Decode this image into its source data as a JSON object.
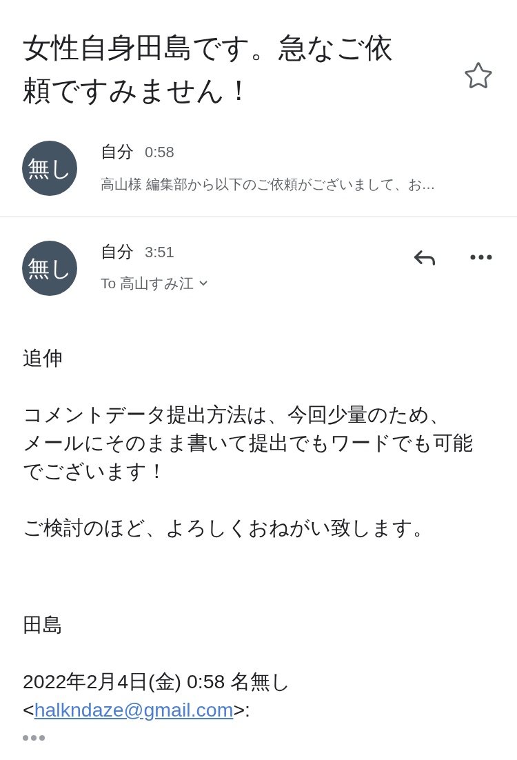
{
  "subject": "女性自身田島です。急なご依頼ですみません！",
  "starred": false,
  "messages": [
    {
      "kind": "collapsed",
      "avatar": "無し",
      "sender": "自分",
      "time": "0:58",
      "snippet": "高山様 編集部から以下のご依頼がございまして、お…"
    },
    {
      "kind": "expanded",
      "avatar": "無し",
      "sender": "自分",
      "time": "3:51",
      "to_label": "To",
      "to": "高山すみ江"
    }
  ],
  "body": [
    {
      "lines": [
        "追伸"
      ]
    },
    {
      "lines": [
        "コメントデータ提出方法は、今回少量のため、",
        "メールにそのまま書いて提出でもワードでも可能",
        "でございます！"
      ]
    },
    {
      "lines": [
        "ご検討のほど、よろしくおねがい致します。"
      ]
    }
  ],
  "signature": "田島",
  "quote_header": {
    "text": "2022年2月4日(金) 0:58 名無し",
    "open": "<",
    "email": "halkndaze@gmail.com",
    "close": ">:"
  }
}
